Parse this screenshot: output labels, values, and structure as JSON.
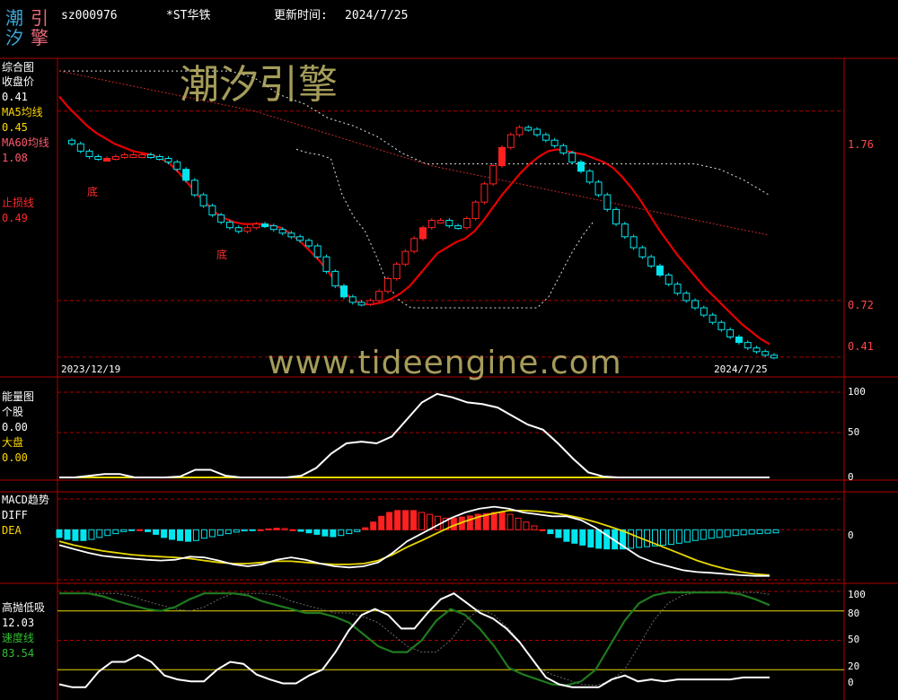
{
  "header": {
    "logo_chars": [
      "潮",
      "引",
      "汐",
      "擎"
    ],
    "code": "sz000976",
    "name": "*ST华铁",
    "update_label": "更新时间:",
    "update_value": "2024/7/25"
  },
  "watermark": {
    "cn": "潮汐引擎",
    "url": "www.tideengine.com"
  },
  "panels": {
    "main": {
      "title": "综合图",
      "close_label": "收盘价",
      "close_value": "0.41",
      "ma5_label": "MA5均线",
      "ma5_value": "0.45",
      "ma60_label": "MA60均线",
      "ma60_value": "1.08",
      "stop_label": "止损线",
      "stop_value": "0.49",
      "date_start": "2023/12/19",
      "date_end": "2024/7/25",
      "bottom_marks": [
        "底",
        "底"
      ],
      "axis": [
        "1.76",
        "0.72",
        "0.41"
      ]
    },
    "energy": {
      "title": "能量图",
      "stock_label": "个股",
      "stock_value": "0.00",
      "market_label": "大盘",
      "market_value": "0.00",
      "axis": [
        "100",
        "50",
        "0"
      ]
    },
    "macd": {
      "title": "MACD趋势",
      "diff_label": "DIFF",
      "dea_label": "DEA",
      "axis": [
        "0"
      ]
    },
    "gaopao": {
      "title": "高抛低吸",
      "value": "12.03",
      "speed_label": "速度线",
      "speed_value": "83.54",
      "axis": [
        "100",
        "80",
        "50",
        "20",
        "0"
      ]
    }
  },
  "colors": {
    "up": "#ff2020",
    "down": "#00e5ee",
    "ma5": "#e60000",
    "ma60": "#c62828",
    "grid": "#b00000",
    "diff": "#ffffff",
    "dea": "#e8d800",
    "speed": "#1f7a1f",
    "market": "#e8d800"
  },
  "chart_data": [
    {
      "type": "candlestick",
      "name_cn": "综合图",
      "x_start": "2023/12/19",
      "x_end": "2024/7/25",
      "ylim": [
        0.35,
        2.0
      ],
      "close": [
        1.58,
        1.54,
        1.51,
        1.5,
        1.5,
        1.51,
        1.52,
        1.52,
        1.52,
        1.51,
        1.5,
        1.48,
        1.44,
        1.38,
        1.3,
        1.24,
        1.19,
        1.15,
        1.12,
        1.1,
        1.12,
        1.14,
        1.13,
        1.11,
        1.09,
        1.07,
        1.05,
        1.02,
        0.96,
        0.88,
        0.8,
        0.74,
        0.71,
        0.7,
        0.72,
        0.77,
        0.84,
        0.92,
        0.99,
        1.06,
        1.12,
        1.16,
        1.16,
        1.13,
        1.12,
        1.17,
        1.26,
        1.36,
        1.46,
        1.56,
        1.63,
        1.67,
        1.66,
        1.63,
        1.6,
        1.57,
        1.53,
        1.48,
        1.43,
        1.37,
        1.3,
        1.22,
        1.14,
        1.07,
        1.01,
        0.96,
        0.91,
        0.86,
        0.81,
        0.76,
        0.72,
        0.68,
        0.64,
        0.6,
        0.56,
        0.52,
        0.49,
        0.46,
        0.44,
        0.42,
        0.41
      ],
      "ma5": [
        1.84,
        1.78,
        1.73,
        1.68,
        1.64,
        1.61,
        1.58,
        1.56,
        1.54,
        1.53,
        1.52,
        1.5,
        1.47,
        1.42,
        1.36,
        1.3,
        1.25,
        1.2,
        1.17,
        1.15,
        1.14,
        1.14,
        1.14,
        1.13,
        1.12,
        1.09,
        1.05,
        1.0,
        0.95,
        0.89,
        0.82,
        0.76,
        0.72,
        0.7,
        0.7,
        0.71,
        0.73,
        0.76,
        0.8,
        0.86,
        0.92,
        0.98,
        1.01,
        1.04,
        1.06,
        1.1,
        1.16,
        1.23,
        1.3,
        1.36,
        1.42,
        1.47,
        1.51,
        1.54,
        1.55,
        1.54,
        1.53,
        1.52,
        1.5,
        1.48,
        1.45,
        1.4,
        1.34,
        1.27,
        1.19,
        1.11,
        1.04,
        0.97,
        0.91,
        0.85,
        0.79,
        0.74,
        0.69,
        0.64,
        0.59,
        0.55,
        0.51,
        0.48
      ],
      "ma60": [
        1.98,
        1.96,
        1.94,
        1.92,
        1.9,
        1.88,
        1.86,
        1.84,
        1.82,
        1.8,
        1.78,
        1.76,
        1.73,
        1.7,
        1.67,
        1.64,
        1.61,
        1.58,
        1.55,
        1.52,
        1.49,
        1.46,
        1.44,
        1.42,
        1.4,
        1.38,
        1.36,
        1.34,
        1.32,
        1.3,
        1.28,
        1.26,
        1.24,
        1.22,
        1.2,
        1.18,
        1.16,
        1.14,
        1.12,
        1.1,
        1.08
      ],
      "band_upper": [
        1.98,
        1.98,
        1.98,
        1.98,
        1.98,
        1.98,
        1.98,
        1.98,
        1.94,
        1.85,
        1.8,
        1.72,
        1.68,
        1.62,
        1.53,
        1.47,
        1.47,
        1.47,
        1.47,
        1.47,
        1.47,
        1.47,
        1.47,
        1.47,
        1.47,
        1.47,
        1.47,
        1.44,
        1.38,
        1.3
      ],
      "band_lower": [
        1.55,
        1.53,
        1.52,
        1.5,
        1.3,
        1.18,
        1.1,
        0.96,
        0.8,
        0.72,
        0.68,
        0.68,
        0.68,
        0.68,
        0.68,
        0.68,
        0.68,
        0.68,
        0.68,
        0.68,
        0.68,
        0.68,
        0.74,
        0.86,
        0.98,
        1.08,
        1.16
      ],
      "hlines": [
        1.76,
        0.72,
        0.41
      ]
    },
    {
      "type": "line",
      "name_cn": "能量图",
      "ylim": [
        0,
        100
      ],
      "series": [
        {
          "name": "个股",
          "values": [
            0,
            0,
            2,
            4,
            4,
            0,
            0,
            0,
            1,
            9,
            9,
            2,
            0,
            0,
            0,
            0,
            2,
            11,
            28,
            40,
            42,
            40,
            48,
            68,
            88,
            98,
            94,
            88,
            86,
            82,
            72,
            62,
            56,
            40,
            22,
            6,
            1,
            0,
            0,
            0,
            0,
            0,
            0,
            0,
            0,
            0,
            0,
            0
          ]
        },
        {
          "name": "大盘",
          "values": [
            0,
            0,
            0,
            0,
            0,
            0,
            0,
            0,
            0,
            0,
            0,
            0,
            0,
            0,
            0,
            0,
            0,
            0,
            0,
            0,
            0,
            0,
            0,
            0,
            0,
            0,
            0,
            0,
            0,
            0,
            0,
            0,
            0,
            0,
            0,
            0,
            0,
            0,
            0,
            0,
            0,
            0,
            0,
            0,
            0,
            0,
            0,
            0
          ]
        }
      ]
    },
    {
      "type": "macd",
      "name_cn": "MACD趋势",
      "ylim": [
        -0.13,
        0.08
      ],
      "hist": [
        -0.02,
        -0.025,
        -0.028,
        -0.028,
        -0.025,
        -0.02,
        -0.015,
        -0.01,
        -0.005,
        -0.002,
        0.0,
        -0.005,
        -0.012,
        -0.02,
        -0.025,
        -0.028,
        -0.03,
        -0.028,
        -0.022,
        -0.018,
        -0.014,
        -0.01,
        -0.006,
        -0.003,
        -0.001,
        0.0,
        0.002,
        0.004,
        0.003,
        0.0,
        -0.004,
        -0.008,
        -0.012,
        -0.016,
        -0.018,
        -0.015,
        -0.01,
        -0.005,
        0.005,
        0.02,
        0.035,
        0.045,
        0.05,
        0.05,
        0.05,
        0.045,
        0.04,
        0.035,
        0.03,
        0.03,
        0.033,
        0.036,
        0.04,
        0.042,
        0.045,
        0.045,
        0.04,
        0.03,
        0.02,
        0.01,
        0.0,
        -0.01,
        -0.02,
        -0.03,
        -0.035,
        -0.04,
        -0.045,
        -0.048,
        -0.05,
        -0.05,
        -0.05,
        -0.048,
        -0.046,
        -0.044,
        -0.042,
        -0.04,
        -0.038,
        -0.035,
        -0.032,
        -0.028,
        -0.025,
        -0.022,
        -0.02,
        -0.018,
        -0.015,
        -0.013,
        -0.011,
        -0.01,
        -0.009,
        -0.008
      ],
      "diff": [
        -0.04,
        -0.05,
        -0.06,
        -0.068,
        -0.072,
        -0.075,
        -0.078,
        -0.08,
        -0.078,
        -0.07,
        -0.072,
        -0.08,
        -0.09,
        -0.095,
        -0.09,
        -0.078,
        -0.072,
        -0.078,
        -0.088,
        -0.095,
        -0.098,
        -0.095,
        -0.085,
        -0.06,
        -0.03,
        -0.01,
        0.01,
        0.03,
        0.045,
        0.055,
        0.06,
        0.055,
        0.045,
        0.04,
        0.035,
        0.035,
        0.025,
        0.005,
        -0.02,
        -0.045,
        -0.07,
        -0.085,
        -0.095,
        -0.105,
        -0.11,
        -0.112,
        -0.115,
        -0.118,
        -0.12,
        -0.12
      ],
      "dea": [
        -0.03,
        -0.04,
        -0.048,
        -0.055,
        -0.06,
        -0.065,
        -0.068,
        -0.07,
        -0.072,
        -0.075,
        -0.08,
        -0.085,
        -0.088,
        -0.088,
        -0.085,
        -0.082,
        -0.082,
        -0.085,
        -0.088,
        -0.09,
        -0.09,
        -0.088,
        -0.08,
        -0.065,
        -0.045,
        -0.028,
        -0.01,
        0.008,
        0.022,
        0.034,
        0.043,
        0.05,
        0.05,
        0.048,
        0.044,
        0.038,
        0.03,
        0.02,
        0.008,
        -0.005,
        -0.02,
        -0.035,
        -0.05,
        -0.065,
        -0.08,
        -0.092,
        -0.102,
        -0.11,
        -0.115,
        -0.118
      ]
    },
    {
      "type": "line",
      "name_cn": "高抛低吸",
      "ylim": [
        0,
        100
      ],
      "series": [
        {
          "name": "高抛低吸",
          "values": [
            5,
            2,
            2,
            18,
            28,
            28,
            35,
            28,
            14,
            10,
            8,
            8,
            20,
            28,
            26,
            15,
            10,
            6,
            6,
            14,
            20,
            38,
            60,
            76,
            82,
            76,
            62,
            62,
            78,
            92,
            98,
            88,
            78,
            72,
            62,
            48,
            30,
            12,
            5,
            2,
            2,
            2,
            10,
            14,
            8,
            10,
            8,
            10,
            10,
            10,
            10,
            10,
            12,
            12,
            12
          ]
        },
        {
          "name": "速度线",
          "values": [
            98,
            98,
            98,
            95,
            90,
            86,
            82,
            80,
            84,
            92,
            98,
            98,
            98,
            96,
            90,
            86,
            82,
            78,
            78,
            74,
            68,
            56,
            44,
            38,
            38,
            50,
            70,
            82,
            76,
            62,
            44,
            22,
            15,
            10,
            5,
            4,
            8,
            20,
            45,
            70,
            88,
            96,
            99,
            99,
            99,
            99,
            99,
            97,
            92,
            86
          ]
        }
      ]
    }
  ]
}
